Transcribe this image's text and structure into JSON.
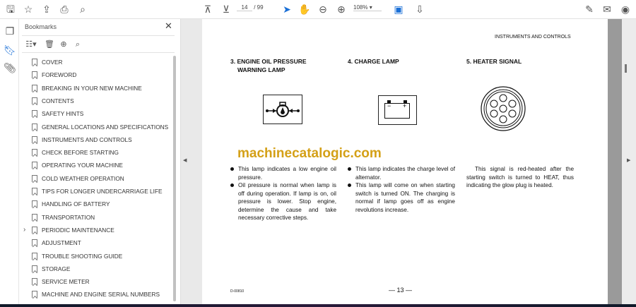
{
  "toolbar": {
    "page_current": "14",
    "page_total": "/ 99",
    "zoom": "108%"
  },
  "bookmarks": {
    "title": "Bookmarks",
    "items": [
      {
        "label": "COVER"
      },
      {
        "label": "FOREWORD"
      },
      {
        "label": "BREAKING IN YOUR NEW MACHINE"
      },
      {
        "label": "CONTENTS"
      },
      {
        "label": "SAFETY HINTS"
      },
      {
        "label": "GENERAL LOCATIONS AND SPECIFICATIONS"
      },
      {
        "label": "INSTRUMENTS AND CONTROLS"
      },
      {
        "label": "CHECK BEFORE STARTING"
      },
      {
        "label": "OPERATING YOUR MACHINE"
      },
      {
        "label": "COLD WEATHER OPERATION"
      },
      {
        "label": "TIPS FOR LONGER UNDERCARRIAGE LIFE"
      },
      {
        "label": "HANDLING OF BATTERY"
      },
      {
        "label": "TRANSPORTATION"
      },
      {
        "label": "PERIODIC MAINTENANCE"
      },
      {
        "label": "ADJUSTMENT"
      },
      {
        "label": "TROUBLE SHOOTING GUIDE"
      },
      {
        "label": "STORAGE"
      },
      {
        "label": "SERVICE METER"
      },
      {
        "label": "MACHINE AND ENGINE SERIAL NUMBERS"
      }
    ]
  },
  "page": {
    "header": "INSTRUMENTS AND CONTROLS",
    "watermark": "machinecatalogic.com",
    "s3": {
      "title1": "3. ENGINE OIL PRESSURE",
      "title2": "WARNING LAMP",
      "b1": "This lamp indicates a low engine oil pressure.",
      "b2": "Oil pressure is normal when lamp is off during operation. If lamp is on, oil pressure is lower. Stop engine, determine the cause and take necessary corrective steps."
    },
    "s4": {
      "title": "4. CHARGE LAMP",
      "minus": "−",
      "plus": "+",
      "b1": "This lamp indicates the charge level of alternator.",
      "b2": "This lamp will come on when starting switch is turned ON. The charging is normal if lamp goes off as engine revolutions increase."
    },
    "s5": {
      "title": "5. HEATER SIGNAL",
      "text": "This signal is red-heated after the starting switch is turned to HEAT, thus indicating the glow plug is heated."
    },
    "code": "D-00810",
    "number": "— 13 —"
  }
}
